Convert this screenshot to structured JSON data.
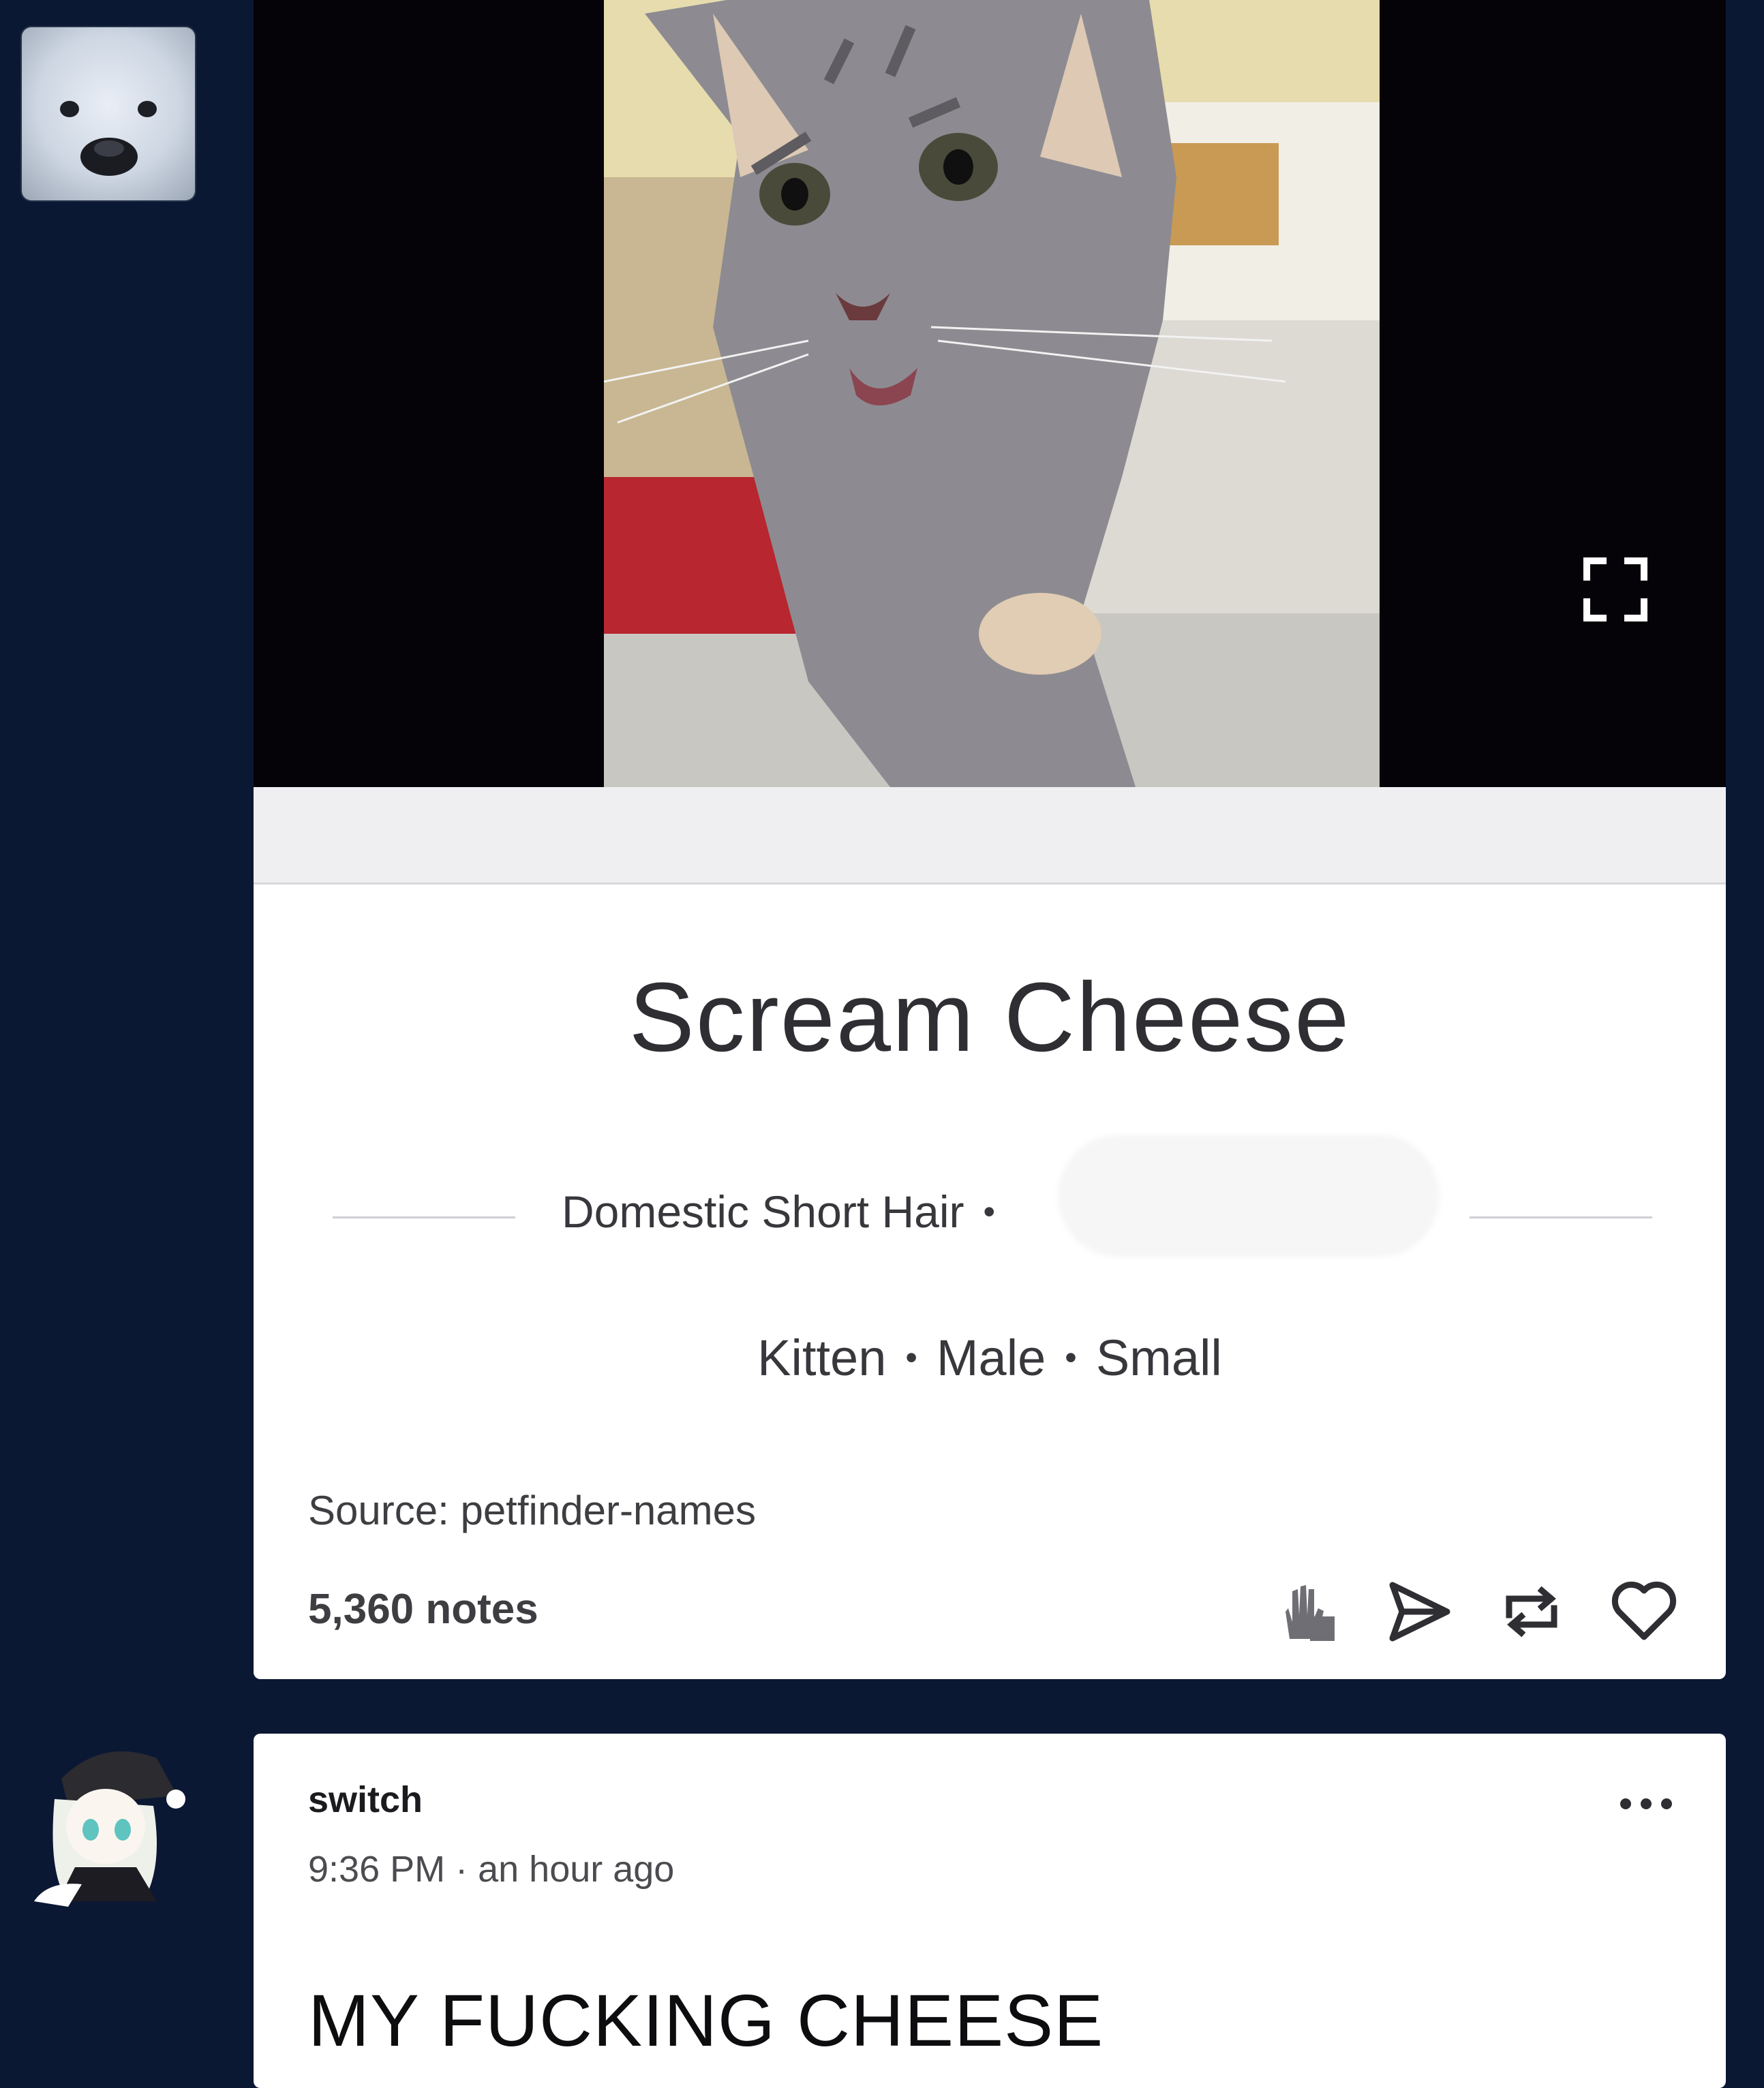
{
  "post1": {
    "pet_name": "Scream Cheese",
    "breed": "Domestic Short Hair",
    "details": [
      "Kitten",
      "Male",
      "Small"
    ],
    "source_label": "Source: petfinder-names",
    "notes": "5,360 notes",
    "photo_icon": "expand-icon",
    "action_icons": [
      "high-five-icon",
      "share-icon",
      "reblog-icon",
      "heart-icon"
    ]
  },
  "post2": {
    "username": "switch",
    "timestamp": "9:36 PM · an hour ago",
    "body_text": "MY FUCKING CHEESE",
    "menu_icon": "more-icon"
  },
  "colors": {
    "background": "#0b1834",
    "card": "#ffffff",
    "text_dark": "#2f2e33"
  }
}
